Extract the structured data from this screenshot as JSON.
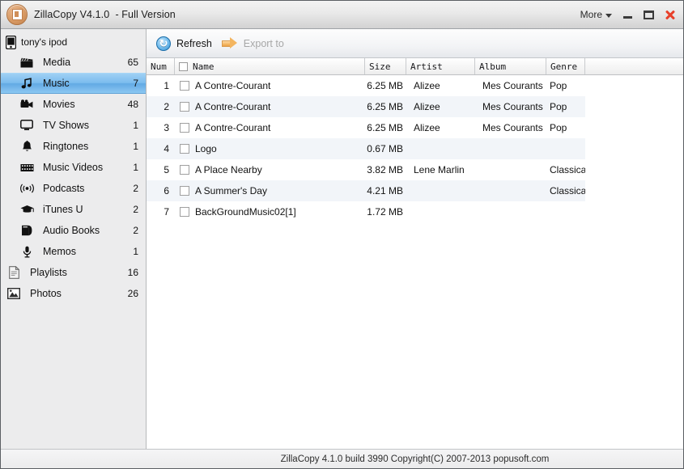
{
  "window": {
    "title": "ZillaCopy V4.1.0  - Full Version",
    "app_icon": "zillacopy-app-icon",
    "more_label": "More",
    "minimize_label": "Minimize",
    "maximize_label": "Maximize",
    "close_label": "Close",
    "close_color": "#e8402a"
  },
  "sidebar": {
    "device": {
      "icon": "ipod-device-icon",
      "label": "tony's ipod"
    },
    "selected": "Music",
    "selection_color": "#7bbcee",
    "items": [
      {
        "icon": "media-clapperboard-icon",
        "label": "Media",
        "count": "65",
        "indent": 1
      },
      {
        "icon": "music-note-icon",
        "label": "Music",
        "count": "7",
        "indent": 1
      },
      {
        "icon": "movie-camera-icon",
        "label": "Movies",
        "count": "48",
        "indent": 1
      },
      {
        "icon": "tv-monitor-icon",
        "label": "TV Shows",
        "count": "1",
        "indent": 1
      },
      {
        "icon": "bell-ringtone-icon",
        "label": "Ringtones",
        "count": "1",
        "indent": 1
      },
      {
        "icon": "film-strip-icon",
        "label": "Music Videos",
        "count": "1",
        "indent": 1
      },
      {
        "icon": "podcast-antenna-icon",
        "label": "Podcasts",
        "count": "2",
        "indent": 1
      },
      {
        "icon": "graduation-cap-icon",
        "label": "iTunes U",
        "count": "2",
        "indent": 1
      },
      {
        "icon": "audio-book-icon",
        "label": "Audio Books",
        "count": "2",
        "indent": 1
      },
      {
        "icon": "microphone-icon",
        "label": "Memos",
        "count": "1",
        "indent": 1
      },
      {
        "icon": "document-icon",
        "label": "Playlists",
        "count": "16",
        "indent": 0
      },
      {
        "icon": "photo-picture-icon",
        "label": "Photos",
        "count": "26",
        "indent": 0
      }
    ]
  },
  "toolbar": {
    "refresh_label": "Refresh",
    "refresh_icon": "refresh-circular-arrows-icon",
    "export_label": "Export to",
    "export_icon": "orange-arrow-right-icon",
    "export_disabled": true
  },
  "table": {
    "headers": {
      "num": "Num",
      "name": "Name",
      "size": "Size",
      "artist": "Artist",
      "album": "Album",
      "genre": "Genre"
    },
    "select_all_checked": false,
    "rows": [
      {
        "num": "1",
        "checked": false,
        "name": "A Contre-Courant",
        "size": "6.25 MB",
        "artist": "Alizee",
        "album": "Mes Courants ...",
        "genre": "Pop"
      },
      {
        "num": "2",
        "checked": false,
        "name": "A Contre-Courant",
        "size": "6.25 MB",
        "artist": "Alizee",
        "album": "Mes Courants ...",
        "genre": "Pop"
      },
      {
        "num": "3",
        "checked": false,
        "name": "A Contre-Courant",
        "size": "6.25 MB",
        "artist": "Alizee",
        "album": "Mes Courants ...",
        "genre": "Pop"
      },
      {
        "num": "4",
        "checked": false,
        "name": "Logo",
        "size": "0.67 MB",
        "artist": "",
        "album": "",
        "genre": ""
      },
      {
        "num": "5",
        "checked": false,
        "name": "A Place Nearby",
        "size": "3.82 MB",
        "artist": "Lene Marlin",
        "album": "",
        "genre": "Classical"
      },
      {
        "num": "6",
        "checked": false,
        "name": "A Summer's Day",
        "size": "4.21 MB",
        "artist": "",
        "album": "",
        "genre": "Classical"
      },
      {
        "num": "7",
        "checked": false,
        "name": "BackGroundMusic02[1]",
        "size": "1.72 MB",
        "artist": "",
        "album": "",
        "genre": ""
      }
    ]
  },
  "statusbar": {
    "text": "ZillaCopy 4.1.0 build 3990 Copyright(C) 2007-2013 popusoft.com"
  }
}
